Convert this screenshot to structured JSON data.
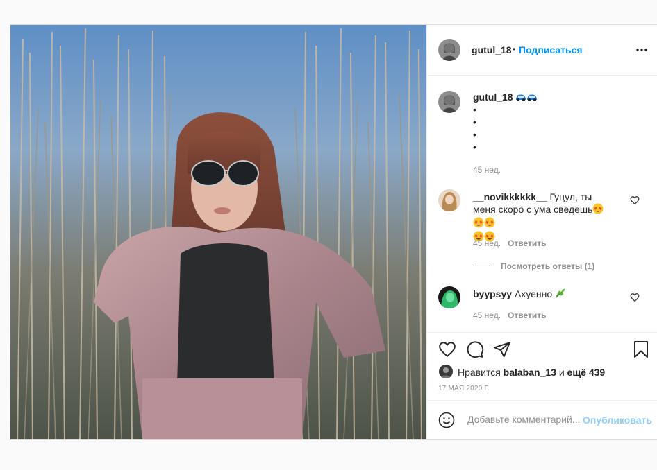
{
  "author": {
    "username": "gutul_18",
    "separator": "•",
    "follow_label": "Подписаться",
    "more_icon": "more-horizontal-icon"
  },
  "caption": {
    "username": "gutul_18",
    "emojis": [
      "car-emoji",
      "car-emoji"
    ],
    "bullets": [
      "•",
      "•",
      "•",
      "•"
    ],
    "time": "45 нед."
  },
  "comments": [
    {
      "username": "__novikkkkkk__",
      "text": "Гуцул, ты меня скоро с ума сведешь",
      "emojis": [
        "star-struck-emoji",
        "star-struck-emoji",
        "star-struck-emoji",
        "star-struck-emoji",
        "star-struck-emoji"
      ],
      "time": "45 нед.",
      "reply_label": "Ответить",
      "view_replies": "Посмотреть ответы (1)"
    },
    {
      "username": "byypsyy",
      "text": "Ахуенно",
      "emojis": [
        "herb-emoji"
      ],
      "time": "45 нед.",
      "reply_label": "Ответить"
    }
  ],
  "likes": {
    "prefix": "Нравится",
    "user": "balaban_13",
    "and": "и",
    "others": "ещё 439"
  },
  "date": "17 МАЯ 2020 Г.",
  "add_comment": {
    "placeholder": "Добавьте комментарий...",
    "display_text": "Добавьте комментарий...",
    "publish_label": "Опубликовать"
  },
  "colors": {
    "link_blue": "#0095f6",
    "secondary_text": "#8e8e8e",
    "border": "#dbdbdb"
  }
}
